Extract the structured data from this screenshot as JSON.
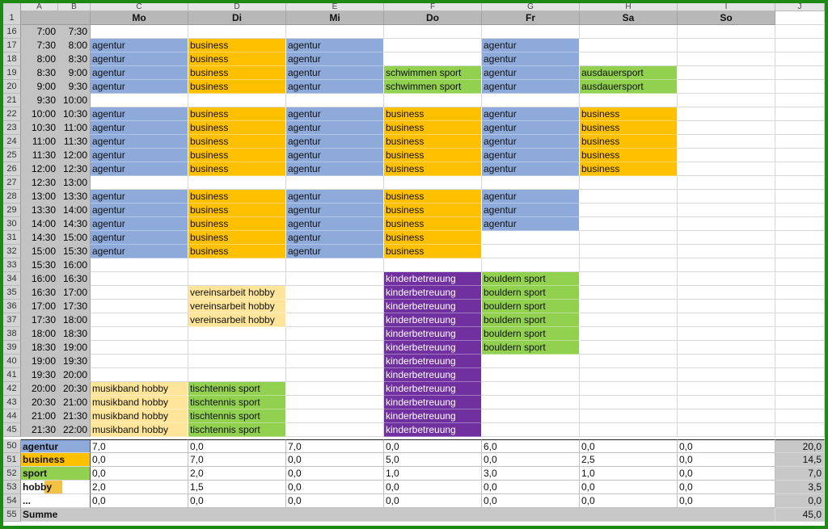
{
  "sheet": {
    "column_letters": [
      "A",
      "B",
      "C",
      "D",
      "E",
      "F",
      "G",
      "H",
      "I",
      "J"
    ],
    "days": [
      "Mo",
      "Di",
      "Mi",
      "Do",
      "Fr",
      "Sa",
      "So"
    ],
    "colors": {
      "agentur": "#8eaadb",
      "business": "#ffc000",
      "sport": "#92d050",
      "hobby": "#fee599",
      "kinderbetreuung": "#7030a0",
      "border": "#1d8a16"
    },
    "header_row_number": "1",
    "rows": [
      {
        "num": "16",
        "from": "7:00",
        "to": "7:30",
        "cells": [
          "",
          "",
          "",
          "",
          "",
          "",
          ""
        ]
      },
      {
        "num": "17",
        "from": "7:30",
        "to": "8:00",
        "cells": [
          "agentur",
          "business",
          "agentur",
          "",
          "agentur",
          "",
          ""
        ]
      },
      {
        "num": "18",
        "from": "8:00",
        "to": "8:30",
        "cells": [
          "agentur",
          "business",
          "agentur",
          "",
          "agentur",
          "",
          ""
        ]
      },
      {
        "num": "19",
        "from": "8:30",
        "to": "9:00",
        "cells": [
          "agentur",
          "business",
          "agentur",
          "schwimmen sport",
          "agentur",
          "ausdauersport",
          ""
        ]
      },
      {
        "num": "20",
        "from": "9:00",
        "to": "9:30",
        "cells": [
          "agentur",
          "business",
          "agentur",
          "schwimmen sport",
          "agentur",
          "ausdauersport",
          ""
        ]
      },
      {
        "num": "21",
        "from": "9:30",
        "to": "10:00",
        "cells": [
          "",
          "",
          "",
          "",
          "",
          "",
          ""
        ]
      },
      {
        "num": "22",
        "from": "10:00",
        "to": "10:30",
        "cells": [
          "agentur",
          "business",
          "agentur",
          "business",
          "agentur",
          "business",
          ""
        ]
      },
      {
        "num": "23",
        "from": "10:30",
        "to": "11:00",
        "cells": [
          "agentur",
          "business",
          "agentur",
          "business",
          "agentur",
          "business",
          ""
        ]
      },
      {
        "num": "24",
        "from": "11:00",
        "to": "11:30",
        "cells": [
          "agentur",
          "business",
          "agentur",
          "business",
          "agentur",
          "business",
          ""
        ]
      },
      {
        "num": "25",
        "from": "11:30",
        "to": "12:00",
        "cells": [
          "agentur",
          "business",
          "agentur",
          "business",
          "agentur",
          "business",
          ""
        ]
      },
      {
        "num": "26",
        "from": "12:00",
        "to": "12:30",
        "cells": [
          "agentur",
          "business",
          "agentur",
          "business",
          "agentur",
          "business",
          ""
        ]
      },
      {
        "num": "27",
        "from": "12:30",
        "to": "13:00",
        "cells": [
          "",
          "",
          "",
          "",
          "",
          "",
          ""
        ]
      },
      {
        "num": "28",
        "from": "13:00",
        "to": "13:30",
        "cells": [
          "agentur",
          "business",
          "agentur",
          "business",
          "agentur",
          "",
          ""
        ]
      },
      {
        "num": "29",
        "from": "13:30",
        "to": "14:00",
        "cells": [
          "agentur",
          "business",
          "agentur",
          "business",
          "agentur",
          "",
          ""
        ]
      },
      {
        "num": "30",
        "from": "14:00",
        "to": "14:30",
        "cells": [
          "agentur",
          "business",
          "agentur",
          "business",
          "agentur",
          "",
          ""
        ]
      },
      {
        "num": "31",
        "from": "14:30",
        "to": "15:00",
        "cells": [
          "agentur",
          "business",
          "agentur",
          "business",
          "",
          "",
          ""
        ]
      },
      {
        "num": "32",
        "from": "15:00",
        "to": "15:30",
        "cells": [
          "agentur",
          "business",
          "agentur",
          "business",
          "",
          "",
          ""
        ]
      },
      {
        "num": "33",
        "from": "15:30",
        "to": "16:00",
        "cells": [
          "",
          "",
          "",
          "",
          "",
          "",
          ""
        ]
      },
      {
        "num": "34",
        "from": "16:00",
        "to": "16:30",
        "cells": [
          "",
          "",
          "",
          "kinderbetreuung",
          "bouldern sport",
          "",
          ""
        ]
      },
      {
        "num": "35",
        "from": "16:30",
        "to": "17:00",
        "cells": [
          "",
          "vereinsarbeit hobby",
          "",
          "kinderbetreuung",
          "bouldern sport",
          "",
          ""
        ]
      },
      {
        "num": "36",
        "from": "17:00",
        "to": "17:30",
        "cells": [
          "",
          "vereinsarbeit hobby",
          "",
          "kinderbetreuung",
          "bouldern sport",
          "",
          ""
        ]
      },
      {
        "num": "37",
        "from": "17:30",
        "to": "18:00",
        "cells": [
          "",
          "vereinsarbeit hobby",
          "",
          "kinderbetreuung",
          "bouldern sport",
          "",
          ""
        ]
      },
      {
        "num": "38",
        "from": "18:00",
        "to": "18:30",
        "cells": [
          "",
          "",
          "",
          "kinderbetreuung",
          "bouldern sport",
          "",
          ""
        ]
      },
      {
        "num": "39",
        "from": "18:30",
        "to": "19:00",
        "cells": [
          "",
          "",
          "",
          "kinderbetreuung",
          "bouldern sport",
          "",
          ""
        ]
      },
      {
        "num": "40",
        "from": "19:00",
        "to": "19:30",
        "cells": [
          "",
          "",
          "",
          "kinderbetreuung",
          "",
          "",
          ""
        ]
      },
      {
        "num": "41",
        "from": "19:30",
        "to": "20:00",
        "cells": [
          "",
          "",
          "",
          "kinderbetreuung",
          "",
          "",
          ""
        ]
      },
      {
        "num": "42",
        "from": "20:00",
        "to": "20:30",
        "cells": [
          "musikband hobby",
          "tischtennis sport",
          "",
          "kinderbetreuung",
          "",
          "",
          ""
        ]
      },
      {
        "num": "43",
        "from": "20:30",
        "to": "21:00",
        "cells": [
          "musikband hobby",
          "tischtennis sport",
          "",
          "kinderbetreuung",
          "",
          "",
          ""
        ]
      },
      {
        "num": "44",
        "from": "21:00",
        "to": "21:30",
        "cells": [
          "musikband hobby",
          "tischtennis sport",
          "",
          "kinderbetreuung",
          "",
          "",
          ""
        ]
      },
      {
        "num": "45",
        "from": "21:30",
        "to": "22:00",
        "cells": [
          "musikband hobby",
          "tischtennis sport",
          "",
          "kinderbetreuung",
          "",
          "",
          ""
        ]
      }
    ],
    "summary": [
      {
        "num": "50",
        "label": "agentur",
        "values": [
          "7,0",
          "0,0",
          "7,0",
          "0,0",
          "6,0",
          "0,0",
          "0,0"
        ],
        "total": "20,0"
      },
      {
        "num": "51",
        "label": "business",
        "values": [
          "0,0",
          "7,0",
          "0,0",
          "5,0",
          "0,0",
          "2,5",
          "0,0"
        ],
        "total": "14,5"
      },
      {
        "num": "52",
        "label": "sport",
        "values": [
          "0,0",
          "2,0",
          "0,0",
          "1,0",
          "3,0",
          "1,0",
          "0,0"
        ],
        "total": "7,0"
      },
      {
        "num": "53",
        "label": "hobby",
        "values": [
          "2,0",
          "1,5",
          "0,0",
          "0,0",
          "0,0",
          "0,0",
          "0,0"
        ],
        "total": "3,5"
      },
      {
        "num": "54",
        "label": "...",
        "values": [
          "0,0",
          "0,0",
          "0,0",
          "0,0",
          "0,0",
          "0,0",
          "0,0"
        ],
        "total": "0,0"
      }
    ],
    "summe": {
      "num": "55",
      "label": "Summe",
      "total": "45,0"
    }
  }
}
